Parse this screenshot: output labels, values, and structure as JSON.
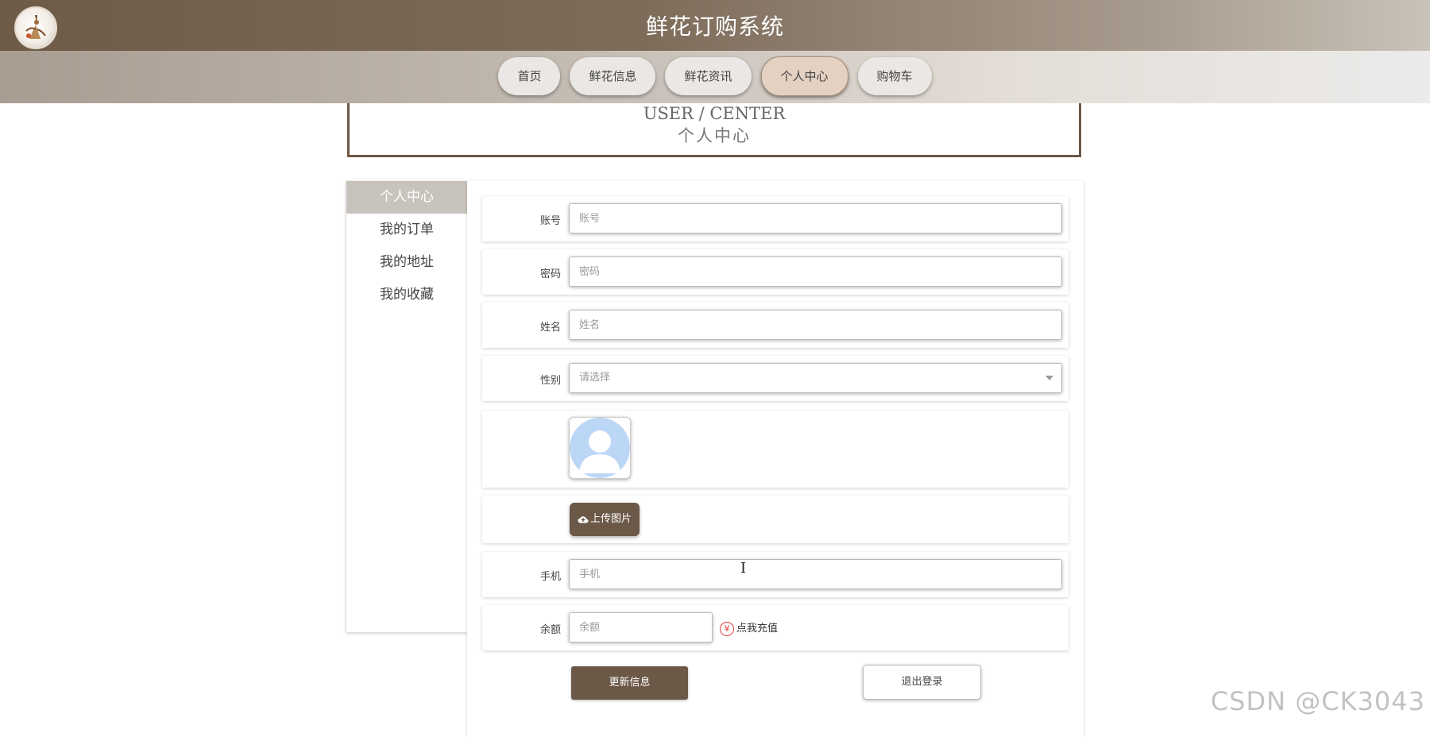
{
  "header": {
    "title": "鲜花订购系统"
  },
  "nav": {
    "items": [
      {
        "label": "首页"
      },
      {
        "label": "鲜花信息"
      },
      {
        "label": "鲜花资讯"
      },
      {
        "label": "个人中心",
        "active": true
      },
      {
        "label": "购物车"
      }
    ]
  },
  "section": {
    "title_en": "USER / CENTER",
    "title_cn": "个人中心"
  },
  "sidebar": {
    "items": [
      {
        "label": "个人中心",
        "active": true
      },
      {
        "label": "我的订单"
      },
      {
        "label": "我的地址"
      },
      {
        "label": "我的收藏"
      }
    ]
  },
  "form": {
    "account": {
      "label": "账号",
      "placeholder": "账号",
      "value": ""
    },
    "password": {
      "label": "密码",
      "placeholder": "密码",
      "value": ""
    },
    "name": {
      "label": "姓名",
      "placeholder": "姓名",
      "value": ""
    },
    "gender": {
      "label": "性别",
      "selected": "请选择"
    },
    "avatar": {
      "icon": "default-avatar-icon"
    },
    "upload_label": "上传图片",
    "phone": {
      "label": "手机",
      "placeholder": "手机",
      "value": ""
    },
    "balance": {
      "label": "余额",
      "placeholder": "余额",
      "value": ""
    },
    "recharge_label": "点我充值",
    "recharge_icon": "¥",
    "update_label": "更新信息",
    "logout_label": "退出登录"
  },
  "watermark": "CSDN @CK3043",
  "colors": {
    "accent": "#6b5847",
    "nav_active": "#e4d1c2",
    "avatar_blue": "#bcd6f6"
  }
}
